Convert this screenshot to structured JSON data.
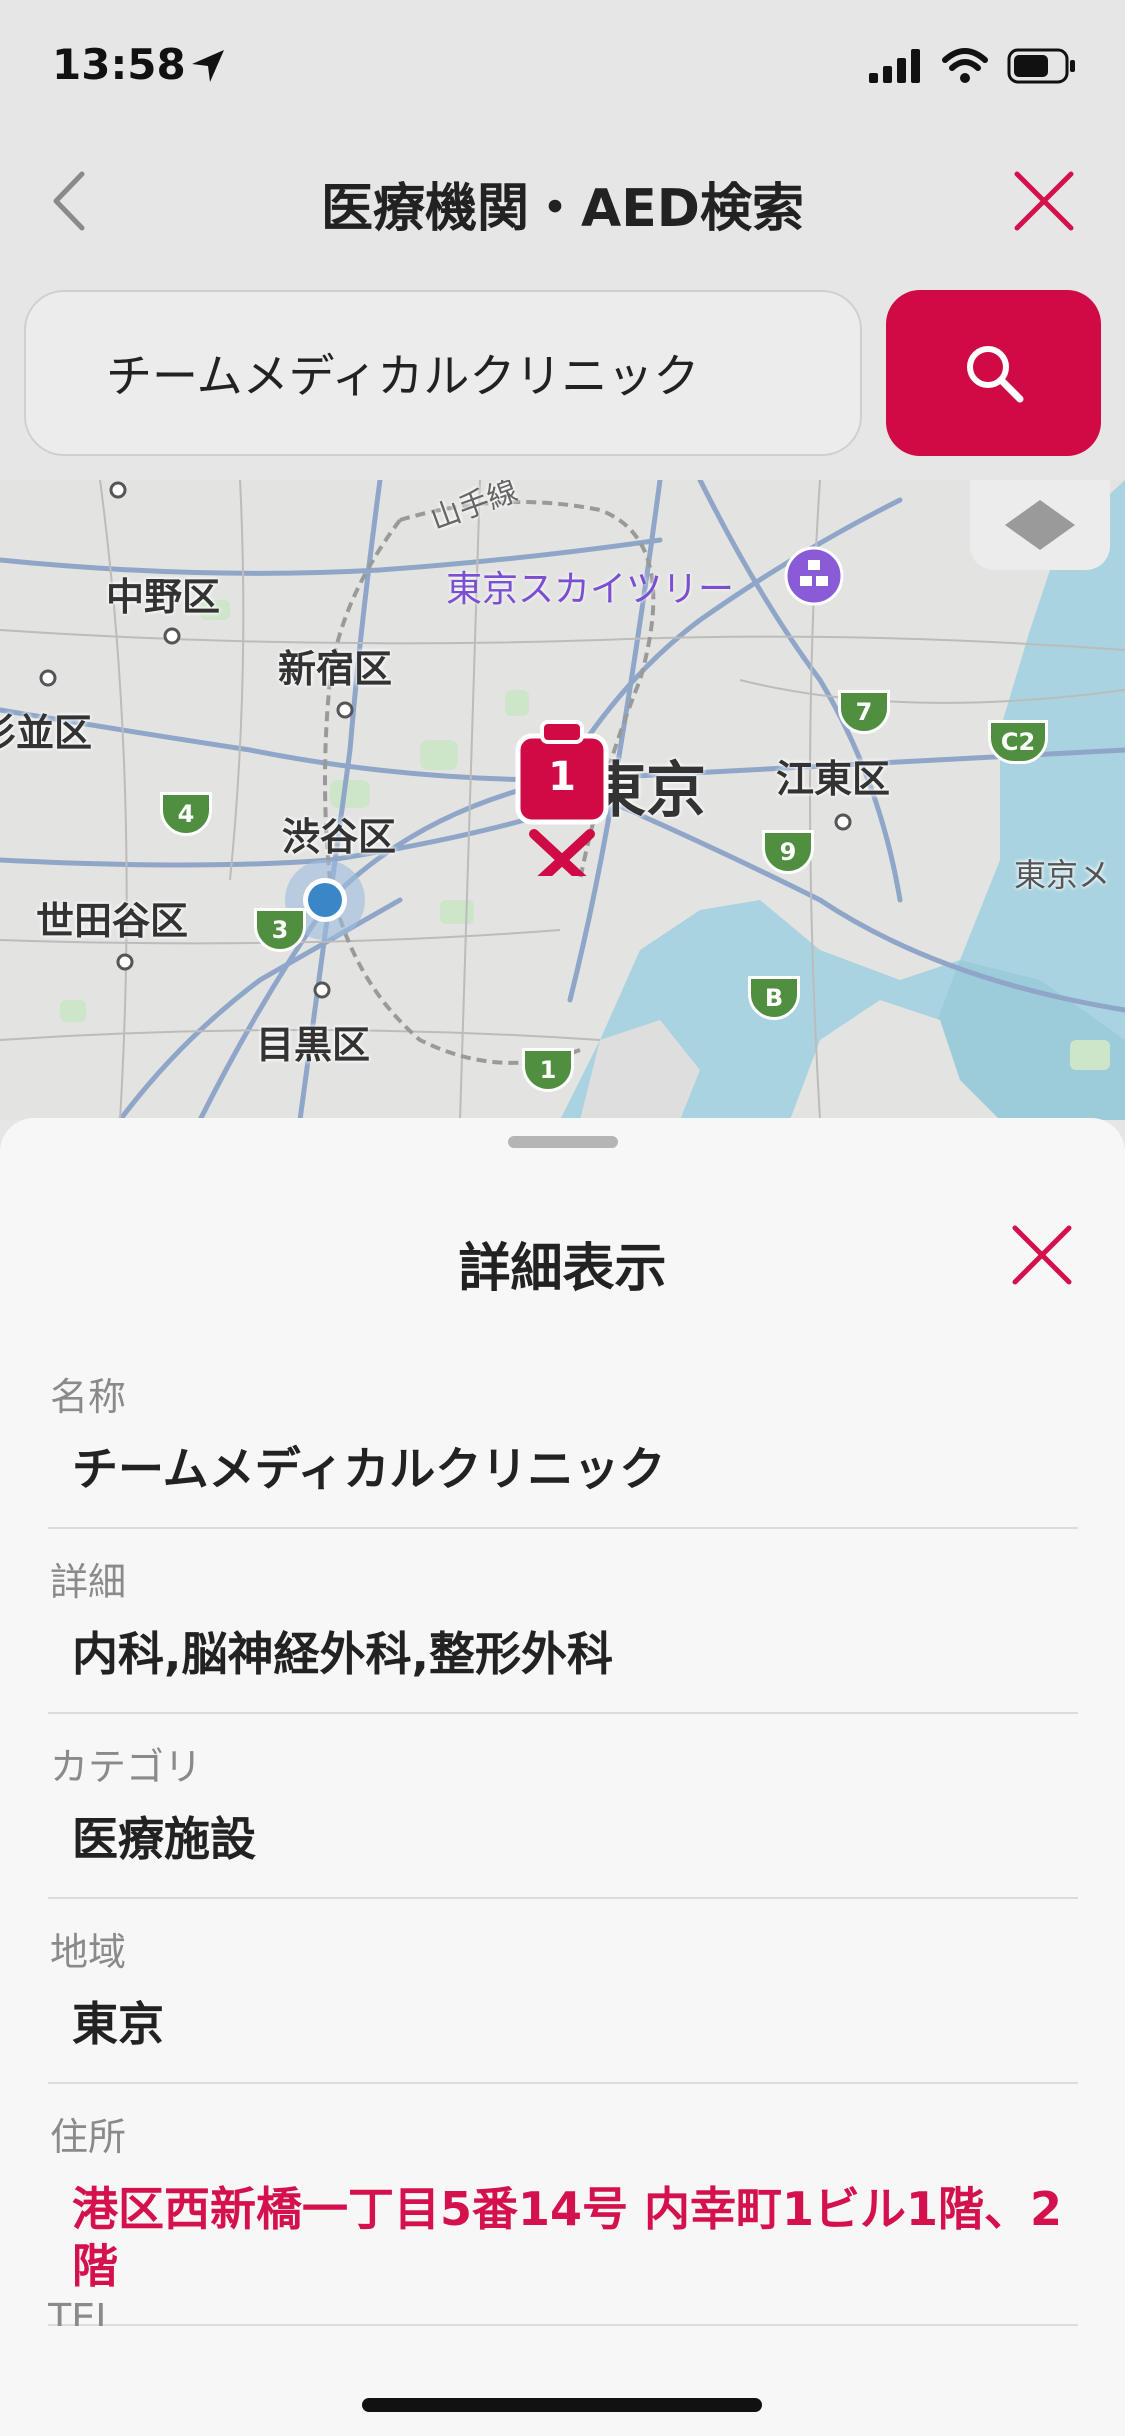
{
  "status_bar": {
    "time": "13:58"
  },
  "nav": {
    "title": "医療機関・AED検索"
  },
  "search": {
    "value": "チームメディカルクリニック"
  },
  "map": {
    "labels": {
      "nakano": "中野区",
      "shinjuku": "新宿区",
      "suginami": "杉並区",
      "shibuya": "渋谷区",
      "setagaya": "世田谷区",
      "meguro": "目黒区",
      "tokyo": "東京",
      "koto": "江東区",
      "yamanote": "山手線",
      "tokyo_me": "東京メ",
      "skytree": "東京スカイツリー"
    },
    "marker_count": "1",
    "route_shields": [
      "4",
      "3",
      "7",
      "C2",
      "9",
      "B",
      "1"
    ]
  },
  "sheet": {
    "title": "詳細表示",
    "rows": [
      {
        "label": "名称",
        "value": "チームメディカルクリニック"
      },
      {
        "label": "詳細",
        "value": "内科,脳神経外科,整形外科"
      },
      {
        "label": "カテゴリ",
        "value": "医療施設"
      },
      {
        "label": "地域",
        "value": "東京"
      },
      {
        "label": "住所",
        "value": "港区西新橋一丁目5番14号 内幸町1ビル1階、2階"
      }
    ],
    "next_label": "TEL"
  },
  "colors": {
    "accent": "#cf0a44",
    "link": "#d4114c"
  }
}
